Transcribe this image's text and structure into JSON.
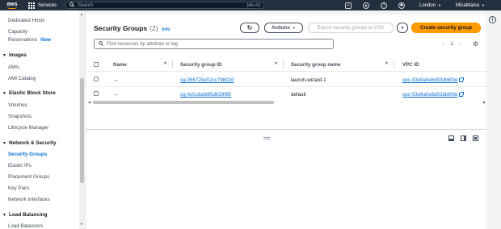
{
  "topnav": {
    "logo_text": "aws",
    "services_label": "Services",
    "search_placeholder": "Search",
    "search_hotkey": "[Alt+S]",
    "region": "London",
    "user": "MicaMaina"
  },
  "sidebar": {
    "items": [
      {
        "label": "Dedicated Hosts"
      },
      {
        "label": "Capacity"
      },
      {
        "label": "Reservations",
        "badge": "New"
      },
      {
        "label": "AMIs"
      },
      {
        "label": "AMI Catalog"
      },
      {
        "label": "Volumes"
      },
      {
        "label": "Snapshots"
      },
      {
        "label": "Lifecycle Manager"
      },
      {
        "label": "Security Groups"
      },
      {
        "label": "Elastic IPs"
      },
      {
        "label": "Placement Groups"
      },
      {
        "label": "Key Pairs"
      },
      {
        "label": "Network Interfaces"
      },
      {
        "label": "Load Balancers"
      }
    ],
    "sections": [
      {
        "label": "Images"
      },
      {
        "label": "Elastic Block Store"
      },
      {
        "label": "Network & Security"
      },
      {
        "label": "Load Balancing"
      }
    ]
  },
  "main": {
    "title": "Security Groups",
    "count": "(2)",
    "info_label": "Info",
    "actions_label": "Actions",
    "export_label": "Export security groups to CSV",
    "create_label": "Create security group",
    "filter_placeholder": "Find resources by attribute or tag",
    "page_number": "1",
    "columns": [
      "Name",
      "Security group ID",
      "Security group name",
      "VPC ID"
    ],
    "rows": [
      {
        "name": "–",
        "sg_id": "sg-056720e02cc79802d",
        "sg_name": "launch-wizard-1",
        "vpc_id": "vpc-03e9a0e6d03db6f3e"
      },
      {
        "name": "–",
        "sg_id": "sg-0c0c8afd95d629f95",
        "sg_name": "default",
        "vpc_id": "vpc-03e9a0e6d03db6f3e"
      }
    ]
  },
  "colors": {
    "nav_bg": "#232f3e",
    "link": "#0972d3",
    "primary": "#ff9900"
  }
}
